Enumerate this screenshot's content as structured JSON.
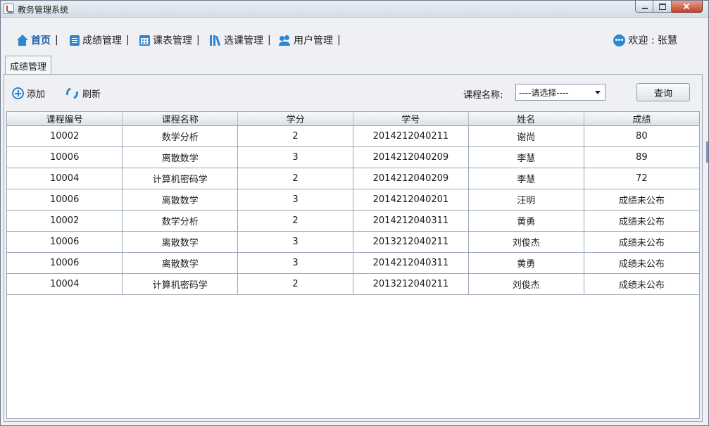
{
  "window": {
    "title": "教务管理系统"
  },
  "nav": {
    "items": [
      {
        "label": "首页",
        "sep": "|",
        "active": true,
        "icon": "home-icon"
      },
      {
        "label": "成绩管理",
        "sep": "|",
        "active": false,
        "icon": "document-icon"
      },
      {
        "label": "课表管理",
        "sep": "|",
        "active": false,
        "icon": "calendar-icon"
      },
      {
        "label": "选课管理",
        "sep": "|",
        "active": false,
        "icon": "books-icon"
      },
      {
        "label": "用户管理",
        "sep": "|",
        "active": false,
        "icon": "users-icon"
      }
    ],
    "welcome": "欢迎 : 张慧"
  },
  "tabs": [
    {
      "label": "成绩管理"
    }
  ],
  "toolbar": {
    "add_label": "添加",
    "refresh_label": "刷新",
    "course_label": "课程名称:",
    "course_select_value": "----请选择----",
    "query_label": "查询"
  },
  "table": {
    "columns": [
      "课程编号",
      "课程名称",
      "学分",
      "学号",
      "姓名",
      "成绩"
    ],
    "rows": [
      [
        "10002",
        "数学分析",
        "2",
        "2014212040211",
        "谢尚",
        "80"
      ],
      [
        "10006",
        "离散数学",
        "3",
        "2014212040209",
        "李慧",
        "89"
      ],
      [
        "10004",
        "计算机密码学",
        "2",
        "2014212040209",
        "李慧",
        "72"
      ],
      [
        "10006",
        "离散数学",
        "3",
        "2014212040201",
        "汪明",
        "成绩未公布"
      ],
      [
        "10002",
        "数学分析",
        "2",
        "2014212040311",
        "黄勇",
        "成绩未公布"
      ],
      [
        "10006",
        "离散数学",
        "3",
        "2013212040211",
        "刘俊杰",
        "成绩未公布"
      ],
      [
        "10006",
        "离散数学",
        "3",
        "2014212040311",
        "黄勇",
        "成绩未公布"
      ],
      [
        "10004",
        "计算机密码学",
        "2",
        "2013212040211",
        "刘俊杰",
        "成绩未公布"
      ]
    ]
  },
  "colors": {
    "accent": "#2f86d1",
    "active_nav": "#1f5fa8"
  }
}
